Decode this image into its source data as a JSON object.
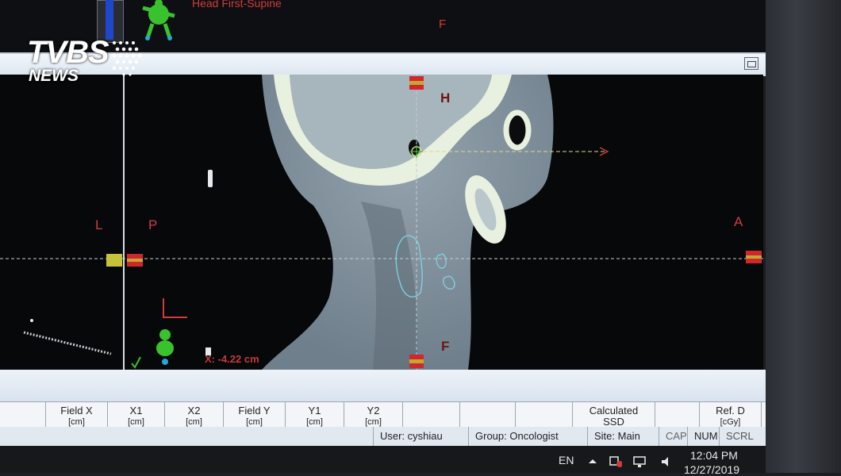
{
  "watermark": {
    "line1": "TVBS",
    "line2": "NEWS"
  },
  "top_view": {
    "orientation_label": "Head First-Supine",
    "direction_bottom": "F"
  },
  "viewport": {
    "orientation": {
      "top": "H",
      "bottom": "F",
      "left_outer": "L",
      "left": "P",
      "right": "A"
    },
    "readout": "X: -4.22 cm"
  },
  "table_columns": [
    {
      "label": "Field X",
      "unit": "[cm]"
    },
    {
      "label": "X1",
      "unit": "[cm]"
    },
    {
      "label": "X2",
      "unit": "[cm]"
    },
    {
      "label": "Field Y",
      "unit": "[cm]"
    },
    {
      "label": "Y1",
      "unit": "[cm]"
    },
    {
      "label": "Y2",
      "unit": "[cm]"
    },
    {
      "label": "",
      "unit": ""
    },
    {
      "label": "",
      "unit": ""
    },
    {
      "label": "",
      "unit": ""
    },
    {
      "label": "Calculated",
      "unit": "SSD"
    },
    {
      "label": "",
      "unit": ""
    },
    {
      "label": "Ref. D",
      "unit": "[cGy]"
    }
  ],
  "status": {
    "user": "User: cyshiau",
    "group": "Group: Oncologist",
    "site": "Site: Main",
    "cap": "CAP",
    "num": "NUM",
    "scrl": "SCRL"
  },
  "taskbar": {
    "language": "EN",
    "time": "12:04 PM",
    "date": "12/27/2019"
  },
  "colors": {
    "orientation_text": "#d23b3b",
    "contour": "#7fd4e6",
    "marker": "#d2262e",
    "crosshair": "#d9d98a"
  }
}
